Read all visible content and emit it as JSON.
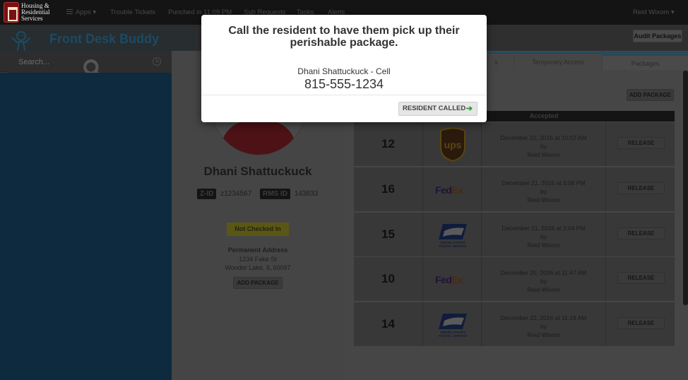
{
  "topbar": {
    "org_line1": "Housing &",
    "org_line2": "Residential",
    "org_line3": "Services",
    "apps": "Apps",
    "nav": [
      "Trouble Tickets",
      "Punched in 11:09 PM",
      "Sub Requests",
      "Tasks",
      "Alerts"
    ],
    "user": "Reid Wixom"
  },
  "header": {
    "brand": "Front Desk Buddy",
    "audit_label": "Audit Packages"
  },
  "search": {
    "placeholder": "Search..."
  },
  "resident": {
    "name": "Dhani Shattuckuck",
    "zid_label": "Z-ID",
    "zid": "z1234567",
    "rms_label": "RMS ID",
    "rms": "143833",
    "status": "Not Checked In",
    "address_label": "Permanent Address",
    "address_line1": "1234 Fake St",
    "address_line2": "Wonder Lake, IL 60097",
    "add_package_label": "ADD PACKAGE"
  },
  "tabs": [
    {
      "label": "s"
    },
    {
      "label": "Temporary Access"
    },
    {
      "label": "Packages",
      "active": true
    }
  ],
  "packages": {
    "add_package_label": "ADD PACKAGE",
    "columns": [
      "",
      "",
      "Accepted",
      ""
    ],
    "rows": [
      {
        "num": "12",
        "carrier": "ups",
        "date": "December 22, 2016 at 10:52 AM",
        "by": "by",
        "user": "Reid Wixom",
        "action": "RELEASE"
      },
      {
        "num": "16",
        "carrier": "fedex",
        "date": "December 21, 2016 at 3:06 PM",
        "by": "by",
        "user": "Reid Wixom",
        "action": "RELEASE"
      },
      {
        "num": "15",
        "carrier": "usps",
        "date": "December 21, 2016 at 3:04 PM",
        "by": "by",
        "user": "Reid Wixom",
        "action": "RELEASE"
      },
      {
        "num": "10",
        "carrier": "fedex",
        "date": "December 20, 2016 at 11:47 AM",
        "by": "by",
        "user": "Reid Wixom",
        "action": "RELEASE"
      },
      {
        "num": "14",
        "carrier": "usps",
        "date": "December 22, 2016 at 11:18 AM",
        "by": "by",
        "user": "Reid Wixom",
        "action": "RELEASE"
      }
    ]
  },
  "carrier_logos": {
    "ups_text": "ups",
    "fedex_fed": "Fed",
    "fedex_ex": "Ex",
    "usps_line1": "UNITED STATES",
    "usps_line2": "POSTAL SERVICE"
  },
  "modal": {
    "title": "Call the resident to have them pick up their perishable package.",
    "contact": "Dhani Shattuckuck - Cell",
    "phone": "815-555-1234",
    "button_label": "RESIDENT CALLED",
    "button_arrow": "➔"
  },
  "colors": {
    "brand_blue": "#1c4a63",
    "modal_bg": "#ffffff",
    "overlay_dim": "#3b3b3b",
    "arrow_green": "#2d9a2d"
  }
}
